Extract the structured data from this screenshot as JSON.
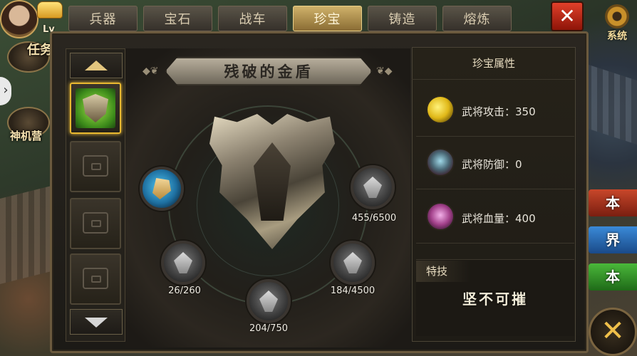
{
  "hud": {
    "level_prefix": "Lv",
    "side_buttons": [
      {
        "label": "任务"
      },
      {
        "label": "神机营"
      }
    ],
    "system_label": "系统",
    "close_symbol": "✕"
  },
  "tabs": [
    {
      "label": "兵器",
      "active": false
    },
    {
      "label": "宝石",
      "active": false
    },
    {
      "label": "战车",
      "active": false
    },
    {
      "label": "珍宝",
      "active": true
    },
    {
      "label": "铸造",
      "active": false
    },
    {
      "label": "熔炼",
      "active": false
    }
  ],
  "item_title": "残破的金盾",
  "slots": [
    {
      "state": "selected",
      "icon": "shield-icon"
    },
    {
      "state": "locked",
      "icon": "chest-icon"
    },
    {
      "state": "locked",
      "icon": "chest-icon"
    },
    {
      "state": "locked",
      "icon": "chest-icon"
    }
  ],
  "orbs": [
    {
      "icon": "blue-gem-icon",
      "progress": ""
    },
    {
      "icon": "silver-shard-icon",
      "progress": "455/6500"
    },
    {
      "icon": "silver-feather-icon",
      "progress": "26/260"
    },
    {
      "icon": "silver-beast-icon",
      "progress": "204/750"
    },
    {
      "icon": "silver-crest-icon",
      "progress": "184/4500"
    }
  ],
  "attributes": {
    "header": "珍宝属性",
    "rows": [
      {
        "icon": "attack-icon",
        "text": "武将攻击：350"
      },
      {
        "icon": "defense-icon",
        "text": "武将防御：0"
      },
      {
        "icon": "hp-icon",
        "text": "武将血量：400"
      }
    ]
  },
  "skill": {
    "tag": "特技",
    "name": "坚不可摧"
  },
  "edge_buttons": [
    {
      "label": "本",
      "color": "#c8472a"
    },
    {
      "label": "界",
      "color": "#3a8ad8"
    },
    {
      "label": "本",
      "color": "#4ab83a"
    }
  ],
  "colors": {
    "active_tab": "#cfb26a",
    "selected_slot": "#e8b830",
    "close_red": "#e0402a"
  }
}
